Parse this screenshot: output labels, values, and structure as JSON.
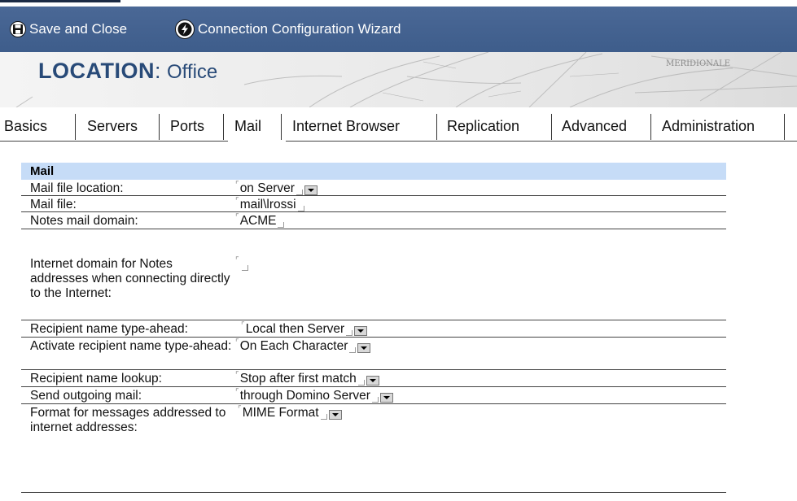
{
  "toolbar": {
    "save_label": "Save and Close",
    "wizard_label": "Connection Configuration Wizard"
  },
  "banner": {
    "label": "LOCATION",
    "separator": ":",
    "value": "Office",
    "map_text": "MERIDIONALE"
  },
  "tabs": [
    "Basics",
    "Servers",
    "Ports",
    "Mail",
    "Internet Browser",
    "Replication",
    "Advanced",
    "Administration"
  ],
  "active_tab": "Mail",
  "section": {
    "title": "Mail"
  },
  "fields": [
    {
      "label": "Mail file location:",
      "value": "on Server",
      "dropdown": true
    },
    {
      "label": "Mail file:",
      "value": "mail\\lrossi",
      "dropdown": false
    },
    {
      "label": "Notes mail domain:",
      "value": "ACME",
      "dropdown": false
    },
    {
      "label": "Internet domain for Notes addresses when connecting directly to the Internet:",
      "value": "",
      "dropdown": false
    },
    {
      "label": "Recipient name type-ahead:",
      "value": "Local then Server",
      "dropdown": true
    },
    {
      "label": "Activate recipient name type-ahead:",
      "value": "On Each Character",
      "dropdown": true
    },
    {
      "label": "Recipient name lookup:",
      "value": "Stop after first match",
      "dropdown": true
    },
    {
      "label": "Send outgoing mail:",
      "value": "through Domino Server",
      "dropdown": true
    },
    {
      "label": "Format for messages addressed to internet addresses:",
      "value": "MIME Format",
      "dropdown": true
    }
  ]
}
